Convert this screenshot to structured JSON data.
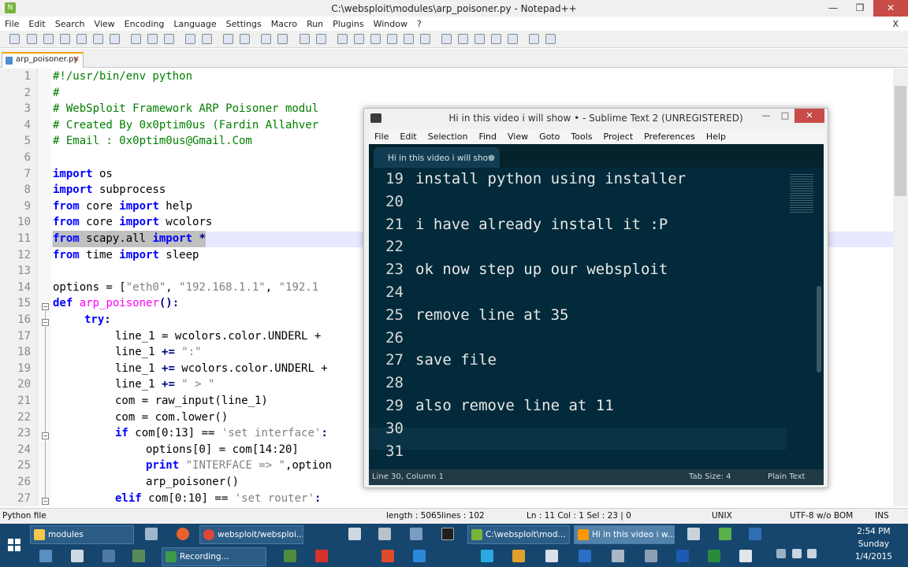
{
  "npp": {
    "window_title": "C:\\websploit\\modules\\arp_poisoner.py - Notepad++",
    "menu": [
      "File",
      "Edit",
      "Search",
      "View",
      "Encoding",
      "Language",
      "Settings",
      "Macro",
      "Run",
      "Plugins",
      "Window",
      "?"
    ],
    "menu_close": "X",
    "tab_label": "arp_poisoner.py",
    "line_numbers": [
      "1",
      "2",
      "3",
      "4",
      "5",
      "6",
      "7",
      "8",
      "9",
      "10",
      "11",
      "12",
      "13",
      "14",
      "15",
      "16",
      "17",
      "18",
      "19",
      "20",
      "21",
      "22",
      "23",
      "24",
      "25",
      "26",
      "27"
    ],
    "code": {
      "l1": "#!/usr/bin/env python",
      "l2": "#",
      "l3": "# WebSploit Framework ARP Poisoner modul",
      "l4": "# Created By 0x0ptim0us (Fardin Allahver",
      "l5": "# Email : 0x0ptim0us@Gmail.Com",
      "import": "import",
      "from": "from",
      "os": " os",
      "subprocess": " subprocess",
      "core": " core ",
      "help": " help",
      "wcolors": " wcolors",
      "scapy": " scapy.all ",
      "star": " *",
      "time": " time ",
      "sleep": " sleep",
      "l14a": "options = [",
      "l14b": "\"eth0\"",
      "l14c": ", ",
      "l14d": "\"192.168.1.1\"",
      "l14e": ", ",
      "l14f": "\"192.1",
      "def": "def",
      "arp_fn": " arp_poisoner",
      "l15b": "():",
      "try": "try",
      "colon": ":",
      "l17": "line_1 = wcolors.color.UNDERL + ",
      "l18a": "line_1 ",
      "l18b": "+=",
      "l18c": " \":\"",
      "l19a": "line_1 ",
      "l19b": "+=",
      "l19c": " wcolors.color.UNDERL + ",
      "l20a": "line_1 ",
      "l20b": "+=",
      "l20c": " \" > \"",
      "l21": "com = raw_input(line_1)",
      "l22": "com = com.lower()",
      "if": "if",
      "l23a": " com[0:13] == ",
      "l23b": "'set interface'",
      "l23c": ":",
      "l24": "options[0] = com[14:20]",
      "print": "print",
      "l25a": " \"INTERFACE => \"",
      "l25b": ",option",
      "l26": "arp_poisoner()",
      "elif": "elif",
      "l27a": " com[0:10] == ",
      "l27b": "'set router'",
      "l27c": ":"
    },
    "status": {
      "lang": "Python file",
      "length": "length : 5065",
      "lines": "lines : 102",
      "pos": "Ln : 11    Col : 1    Sel : 23 | 0",
      "eol": "UNIX",
      "enc": "UTF-8 w/o BOM",
      "ins": "INS"
    }
  },
  "sublime": {
    "window_title": "Hi in this video i will show • - Sublime Text 2 (UNREGISTERED)",
    "menu": [
      "File",
      "Edit",
      "Selection",
      "Find",
      "View",
      "Goto",
      "Tools",
      "Project",
      "Preferences",
      "Help"
    ],
    "tab_label": "Hi in this video i will show",
    "tab_dot": "●",
    "lines": [
      {
        "n": "19",
        "t": "install python using installer"
      },
      {
        "n": "20",
        "t": ""
      },
      {
        "n": "21",
        "t": "i have already install it :P"
      },
      {
        "n": "22",
        "t": ""
      },
      {
        "n": "23",
        "t": "ok now step up our websploit"
      },
      {
        "n": "24",
        "t": ""
      },
      {
        "n": "25",
        "t": "remove line at 35"
      },
      {
        "n": "26",
        "t": ""
      },
      {
        "n": "27",
        "t": "save file"
      },
      {
        "n": "28",
        "t": ""
      },
      {
        "n": "29",
        "t": "also remove line at 11"
      },
      {
        "n": "30",
        "t": ""
      },
      {
        "n": "31",
        "t": ""
      }
    ],
    "status_left": "Line 30, Column 1",
    "status_tab": "Tab Size: 4",
    "status_syntax": "Plain Text"
  },
  "taskbar": {
    "row1": [
      "modules",
      "websploit/websploi...",
      "C:\\websploit\\mod...",
      "Hi in this video i w..."
    ],
    "row2": [
      "Recording..."
    ],
    "time": "2:54 PM",
    "day": "Sunday",
    "date": "1/4/2015"
  },
  "colors": {
    "sublime_bg": "#022a3a",
    "taskbar": "#16466e",
    "npp_keyword": "#0000ff",
    "npp_comment": "#008000"
  }
}
